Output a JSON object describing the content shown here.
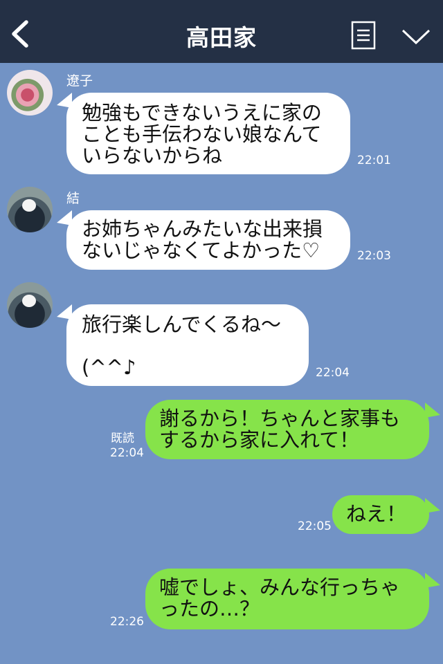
{
  "header": {
    "title": "高田家",
    "back_icon": "chevron-left-icon",
    "notes_icon": "notes-icon",
    "menu_icon": "chevron-down-icon"
  },
  "messages": [
    {
      "side": "left",
      "sender": "遼子",
      "lines": "勉強もできないうえに家の\nことも手伝わない娘なんて\nいらないからね",
      "time": "22:01"
    },
    {
      "side": "left",
      "sender": "結",
      "lines": "お姉ちゃんみたいな出来損\nないじゃなくてよかった♡",
      "time": "22:03"
    },
    {
      "side": "left",
      "sender": "",
      "lines": "旅行楽しんでくるね〜\n\n(^^♪",
      "time": "22:04"
    },
    {
      "side": "right",
      "read": "既読",
      "lines": "謝るから！ちゃんと家事も\nするから家に入れて！",
      "time": "22:04"
    },
    {
      "side": "right",
      "read": "",
      "lines": "ねえ！",
      "time": "22:05"
    },
    {
      "side": "right",
      "read": "",
      "lines": "嘘でしょ、みんな行っちゃ\nったの…？",
      "time": "22:26"
    }
  ],
  "colors": {
    "background": "#7293c5",
    "header": "#243045",
    "self_bubble": "#86e34a",
    "other_bubble": "#ffffff"
  }
}
